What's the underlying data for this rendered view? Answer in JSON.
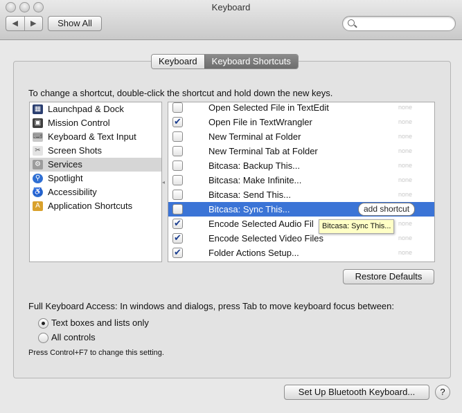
{
  "window": {
    "title": "Keyboard"
  },
  "toolbar": {
    "back": "◀",
    "forward": "▶",
    "show_all": "Show All",
    "search_placeholder": "",
    "search_value": ""
  },
  "tabs": [
    {
      "label": "Keyboard",
      "active": false
    },
    {
      "label": "Keyboard Shortcuts",
      "active": true
    }
  ],
  "instruction": "To change a shortcut, double-click the shortcut and hold down the new keys.",
  "categories": [
    {
      "label": "Launchpad & Dock",
      "icon": "launchpad-icon"
    },
    {
      "label": "Mission Control",
      "icon": "mission-control-icon"
    },
    {
      "label": "Keyboard & Text Input",
      "icon": "keyboard-icon"
    },
    {
      "label": "Screen Shots",
      "icon": "screenshot-icon"
    },
    {
      "label": "Services",
      "icon": "gear-icon",
      "selected": true
    },
    {
      "label": "Spotlight",
      "icon": "spotlight-icon"
    },
    {
      "label": "Accessibility",
      "icon": "accessibility-icon"
    },
    {
      "label": "Application Shortcuts",
      "icon": "app-shortcuts-icon"
    }
  ],
  "shortcuts": [
    {
      "label": "Open Selected File in TextEdit",
      "checked": false,
      "shortcut": "none"
    },
    {
      "label": "Open File in TextWrangler",
      "checked": true,
      "shortcut": "none"
    },
    {
      "label": "New Terminal at Folder",
      "checked": false,
      "shortcut": "none"
    },
    {
      "label": "New Terminal Tab at Folder",
      "checked": false,
      "shortcut": "none"
    },
    {
      "label": "Bitcasa: Backup This...",
      "checked": false,
      "shortcut": "none"
    },
    {
      "label": "Bitcasa: Make Infinite...",
      "checked": false,
      "shortcut": "none"
    },
    {
      "label": "Bitcasa: Send This...",
      "checked": false,
      "shortcut": "none"
    },
    {
      "label": "Bitcasa: Sync This...",
      "checked": false,
      "shortcut": "",
      "selected": true,
      "add_label": "add shortcut"
    },
    {
      "label": "Encode Selected Audio Fil",
      "checked": true,
      "shortcut": "none"
    },
    {
      "label": "Encode Selected Video Files",
      "checked": true,
      "shortcut": "none"
    },
    {
      "label": "Folder Actions Setup...",
      "checked": true,
      "shortcut": "none"
    }
  ],
  "tooltip": "Bitcasa: Sync This...",
  "restore_defaults": "Restore Defaults",
  "full_keyboard_access": {
    "label": "Full Keyboard Access: In windows and dialogs, press Tab to move keyboard focus between:",
    "options": [
      {
        "label": "Text boxes and lists only",
        "selected": true
      },
      {
        "label": "All controls",
        "selected": false
      }
    ],
    "note": "Press Control+F7 to change this setting."
  },
  "bluetooth_button": "Set Up Bluetooth Keyboard...",
  "help": "?",
  "colors": {
    "selection": "#3b74d6",
    "tooltip": "#ffffc6"
  }
}
